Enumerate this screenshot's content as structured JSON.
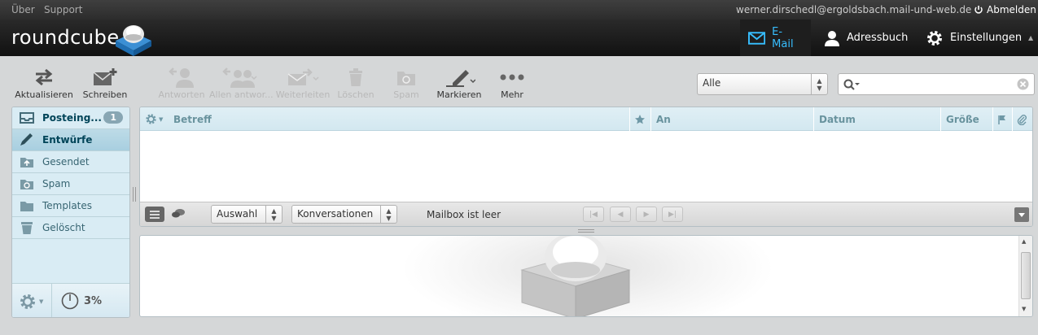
{
  "topline": {
    "about": "Über",
    "support": "Support",
    "user": "werner.dirschedl@ergoldsbach.mail-und-web.de",
    "logout": "Abmelden"
  },
  "header": {
    "logo": "roundcube",
    "tasks": [
      {
        "label": "E-Mail",
        "icon": "envelope-icon",
        "active": true
      },
      {
        "label": "Adressbuch",
        "icon": "person-icon",
        "active": false
      },
      {
        "label": "Einstellungen",
        "icon": "gear-icon",
        "active": false
      }
    ]
  },
  "toolbar": {
    "refresh": "Aktualisieren",
    "compose": "Schreiben",
    "reply": "Antworten",
    "reply_all": "Allen antwor...",
    "forward": "Weiterleiten",
    "delete": "Löschen",
    "spam": "Spam",
    "mark": "Markieren",
    "more": "Mehr"
  },
  "filter": {
    "selected": "Alle"
  },
  "search": {
    "placeholder": ""
  },
  "folders": [
    {
      "label": "Posteing...",
      "icon": "inbox-icon",
      "unread": "1",
      "bold": true,
      "selected": false
    },
    {
      "label": "Entwürfe",
      "icon": "pencil-icon",
      "bold": true,
      "selected": true
    },
    {
      "label": "Gesendet",
      "icon": "sent-icon",
      "bold": false,
      "selected": false
    },
    {
      "label": "Spam",
      "icon": "spam-icon",
      "bold": false,
      "selected": false
    },
    {
      "label": "Templates",
      "icon": "folder-icon",
      "bold": false,
      "selected": false
    },
    {
      "label": "Gelöscht",
      "icon": "trash-icon",
      "bold": false,
      "selected": false
    }
  ],
  "quota": "3%",
  "columns": {
    "subject": "Betreff",
    "to": "An",
    "date": "Datum",
    "size": "Größe"
  },
  "listfooter": {
    "select": "Auswahl",
    "threads": "Konversationen",
    "status": "Mailbox ist leer"
  },
  "colors": {
    "accent": "#37beff",
    "header_bg": "#1a1a1a",
    "folder_bg": "#d9ecf4",
    "list_head_bg": "#d3e8f0"
  }
}
